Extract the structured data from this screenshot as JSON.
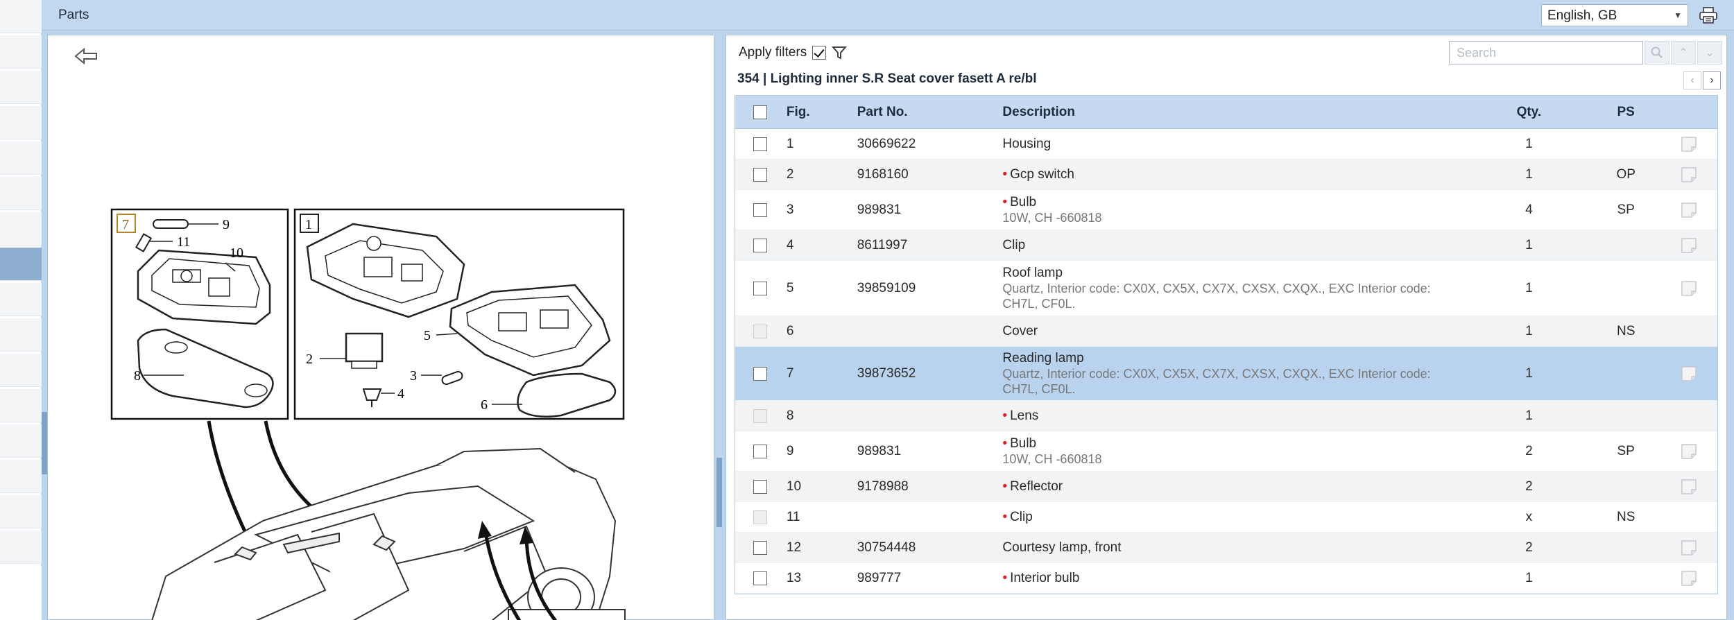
{
  "header": {
    "title": "Parts",
    "language": "English, GB"
  },
  "filters": {
    "apply_filters_label": "Apply filters",
    "search_placeholder": "Search"
  },
  "group": {
    "title": "354  |  Lighting inner S.R Seat cover fasett A re/bl"
  },
  "table": {
    "headers": {
      "fig": "Fig.",
      "part_no": "Part No.",
      "description": "Description",
      "qty": "Qty.",
      "ps": "PS"
    },
    "rows": [
      {
        "fig": "1",
        "part_no": "30669622",
        "desc": "Housing",
        "sub": "",
        "qty": "1",
        "ps": "",
        "bullet": false,
        "enabled": true,
        "note": true
      },
      {
        "fig": "2",
        "part_no": "9168160",
        "desc": "Gcp switch",
        "sub": "",
        "qty": "1",
        "ps": "OP",
        "bullet": true,
        "enabled": true,
        "note": true
      },
      {
        "fig": "3",
        "part_no": "989831",
        "desc": "Bulb",
        "sub": "10W, CH -660818",
        "qty": "4",
        "ps": "SP",
        "bullet": true,
        "enabled": true,
        "note": true
      },
      {
        "fig": "4",
        "part_no": "8611997",
        "desc": "Clip",
        "sub": "",
        "qty": "1",
        "ps": "",
        "bullet": false,
        "enabled": true,
        "note": true
      },
      {
        "fig": "5",
        "part_no": "39859109",
        "desc": "Roof lamp",
        "sub": "Quartz, Interior code: CX0X, CX5X, CX7X, CXSX, CXQX., EXC Interior code: CH7L, CF0L.",
        "qty": "1",
        "ps": "",
        "bullet": false,
        "enabled": true,
        "note": true
      },
      {
        "fig": "6",
        "part_no": "",
        "desc": "Cover",
        "sub": "",
        "qty": "1",
        "ps": "NS",
        "bullet": false,
        "enabled": false,
        "note": false
      },
      {
        "fig": "7",
        "part_no": "39873652",
        "desc": "Reading lamp",
        "sub": "Quartz, Interior code: CX0X, CX5X, CX7X, CXSX, CXQX., EXC Interior code: CH7L, CF0L.",
        "qty": "1",
        "ps": "",
        "bullet": false,
        "enabled": true,
        "note": true,
        "selected": true
      },
      {
        "fig": "8",
        "part_no": "",
        "desc": "Lens",
        "sub": "",
        "qty": "1",
        "ps": "",
        "bullet": true,
        "enabled": false,
        "note": false
      },
      {
        "fig": "9",
        "part_no": "989831",
        "desc": "Bulb",
        "sub": "10W, CH -660818",
        "qty": "2",
        "ps": "SP",
        "bullet": true,
        "enabled": true,
        "note": true
      },
      {
        "fig": "10",
        "part_no": "9178988",
        "desc": "Reflector",
        "sub": "",
        "qty": "2",
        "ps": "",
        "bullet": true,
        "enabled": true,
        "note": true
      },
      {
        "fig": "11",
        "part_no": "",
        "desc": "Clip",
        "sub": "",
        "qty": "x",
        "ps": "NS",
        "bullet": true,
        "enabled": false,
        "note": false
      },
      {
        "fig": "12",
        "part_no": "30754448",
        "desc": "Courtesy lamp, front",
        "sub": "",
        "qty": "2",
        "ps": "",
        "bullet": false,
        "enabled": true,
        "note": true
      },
      {
        "fig": "13",
        "part_no": "989777",
        "desc": "Interior bulb",
        "sub": "",
        "qty": "1",
        "ps": "",
        "bullet": true,
        "enabled": true,
        "note": true
      }
    ]
  },
  "diagram": {
    "callouts": [
      "7",
      "9",
      "11",
      "10",
      "8",
      "1",
      "2",
      "3",
      "4",
      "5",
      "6"
    ]
  }
}
